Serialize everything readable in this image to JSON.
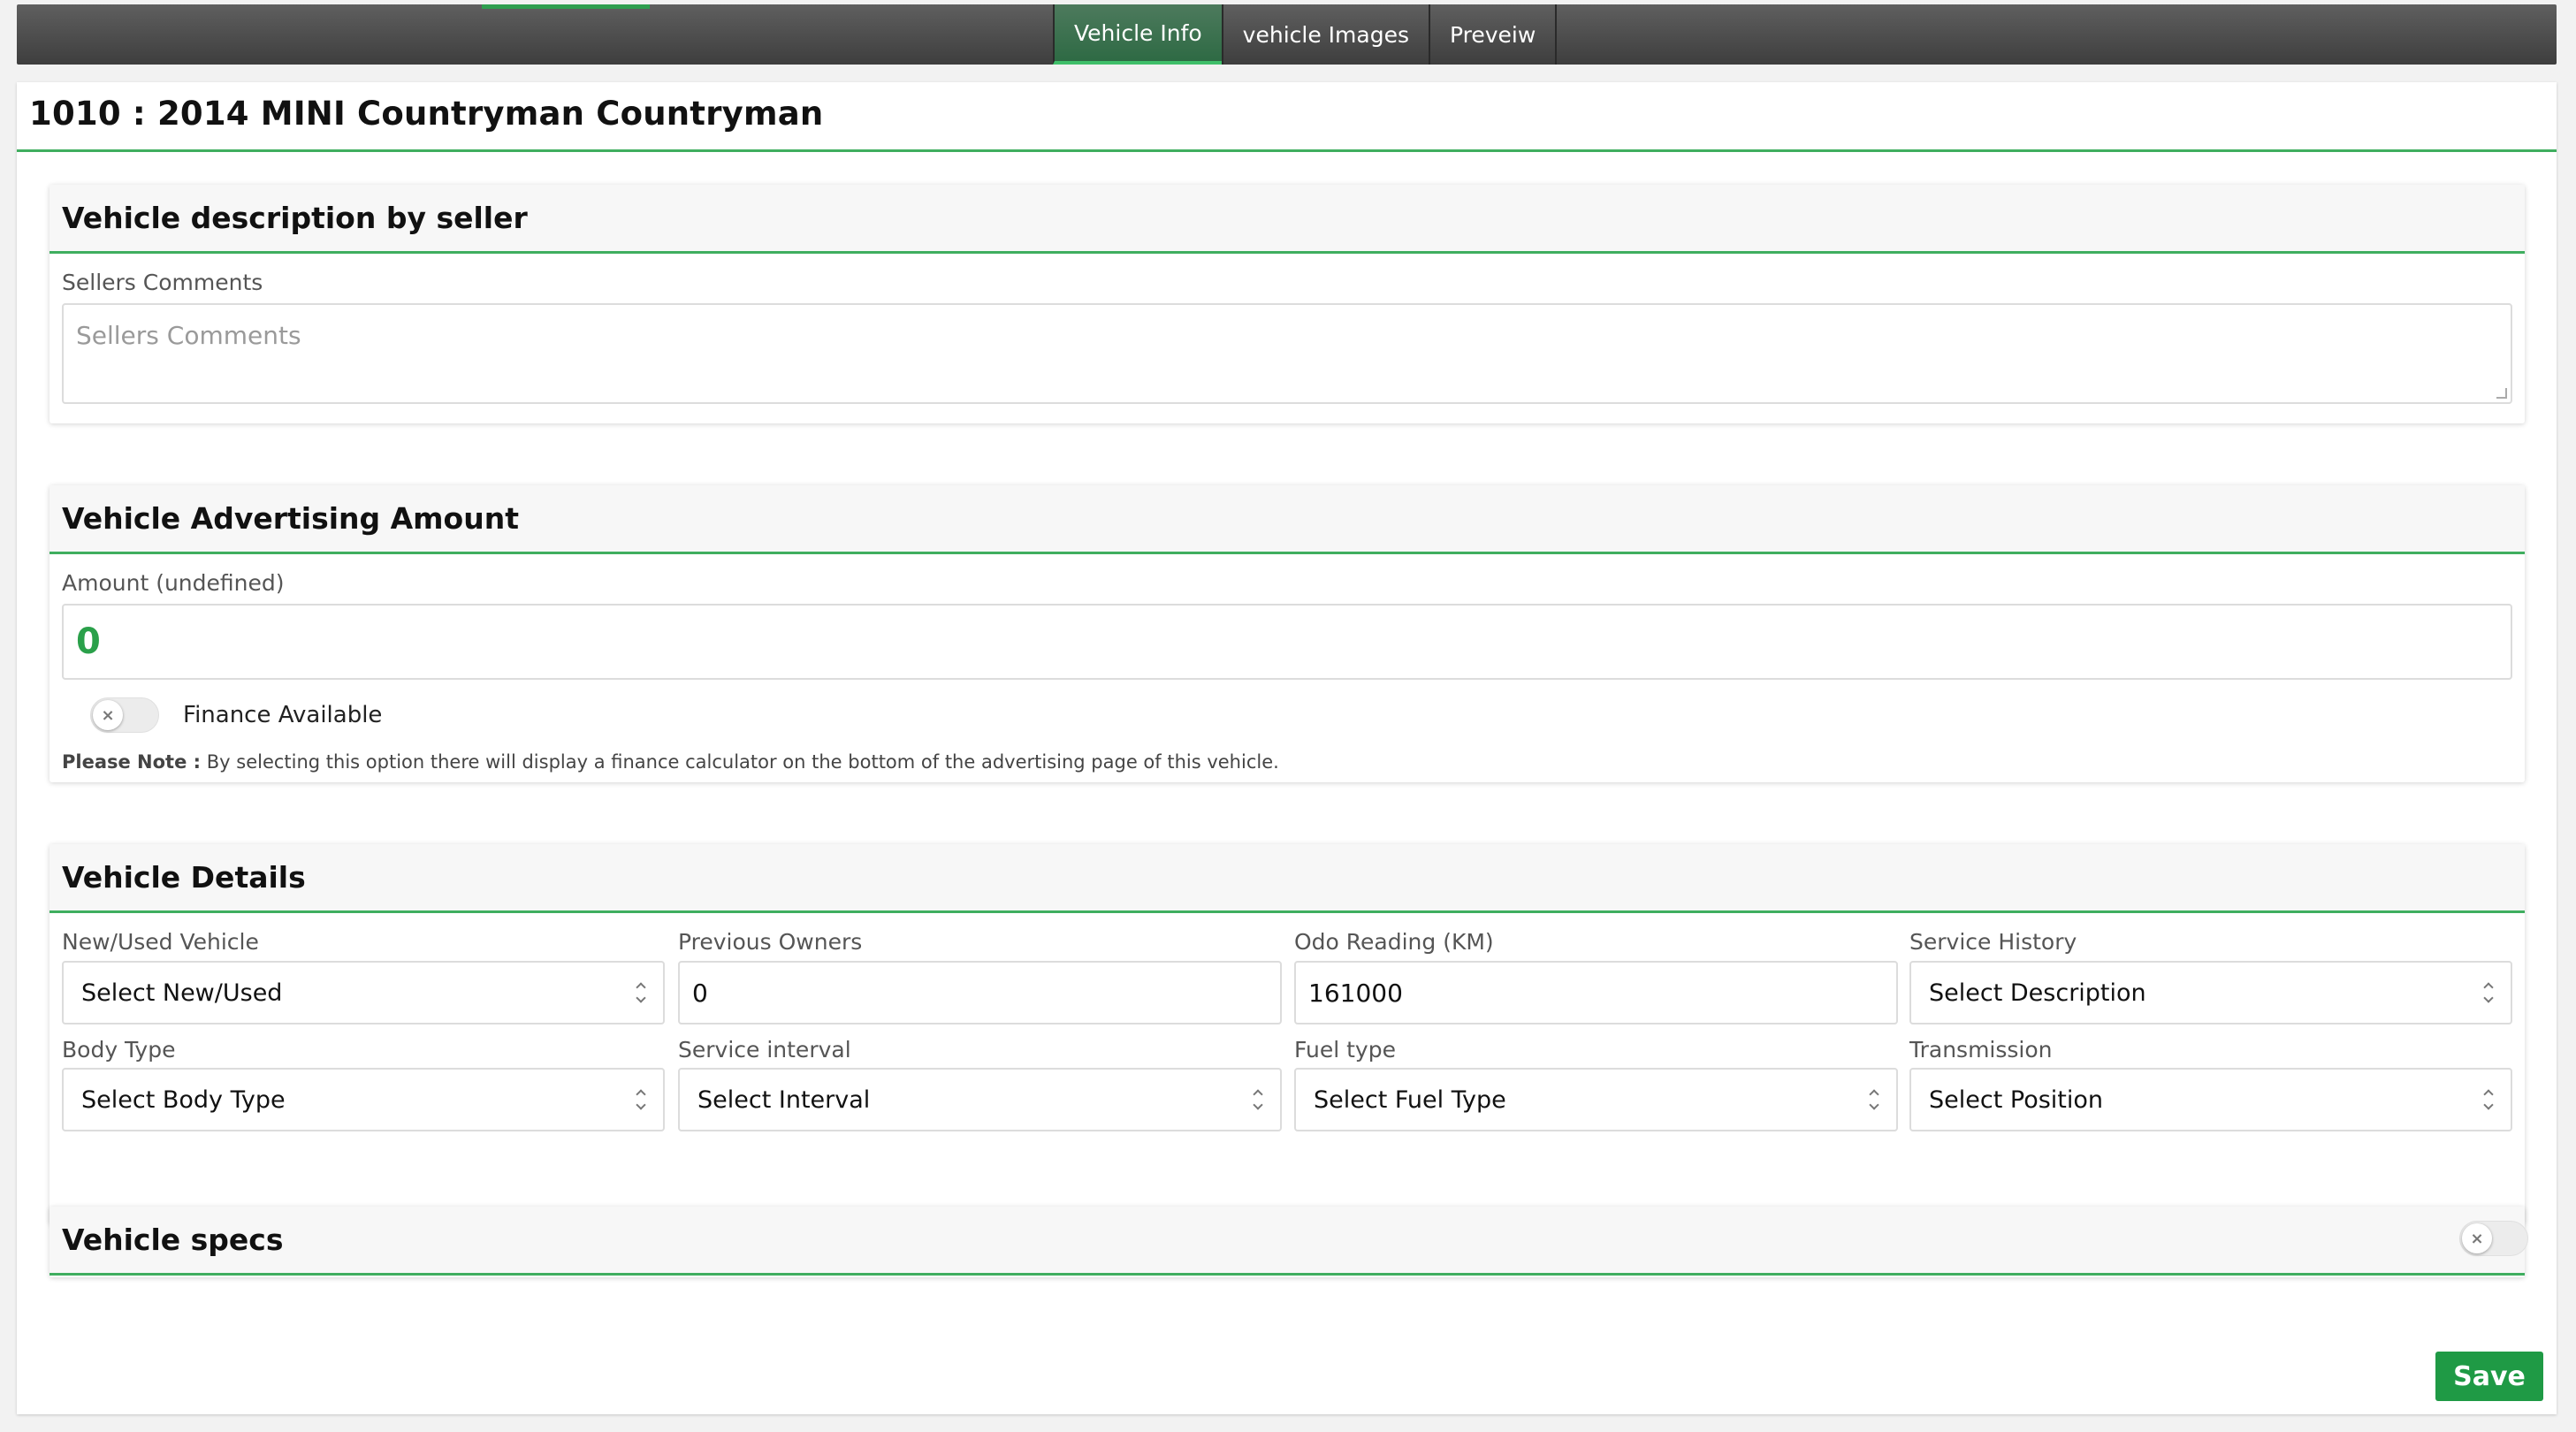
{
  "nav": {
    "tabs": [
      {
        "label": "Vehicle Info",
        "active": true
      },
      {
        "label": "vehicle Images",
        "active": false
      },
      {
        "label": "Preveiw",
        "active": false
      }
    ]
  },
  "page": {
    "title": "1010 : 2014 MINI Countryman Countryman"
  },
  "description_section": {
    "title": "Vehicle description by seller",
    "comments_label": "Sellers Comments",
    "comments_placeholder": "Sellers Comments",
    "comments_value": ""
  },
  "advertising_section": {
    "title": "Vehicle Advertising Amount",
    "amount_label": "Amount (undefined)",
    "amount_value": "0",
    "finance_toggle_label": "Finance Available",
    "finance_toggle_on": false,
    "toggle_off_glyph": "×",
    "note_prefix": "Please Note :",
    "note_text": "By selecting this option there will display a finance calculator on the bottom of the advertising page of this vehicle."
  },
  "details_section": {
    "title": "Vehicle Details",
    "fields": {
      "new_used": {
        "label": "New/Used Vehicle",
        "value": "Select New/Used"
      },
      "previous_owners": {
        "label": "Previous Owners",
        "value": "0"
      },
      "odo_reading": {
        "label": "Odo Reading (KM)",
        "value": "161000"
      },
      "service_history": {
        "label": "Service History",
        "value": "Select Description"
      },
      "body_type": {
        "label": "Body Type",
        "value": "Select Body Type"
      },
      "service_interval": {
        "label": "Service interval",
        "value": "Select Interval"
      },
      "fuel_type": {
        "label": "Fuel type",
        "value": "Select Fuel Type"
      },
      "transmission": {
        "label": "Transmission",
        "value": "Select Position"
      }
    }
  },
  "specs_section": {
    "title": "Vehicle specs",
    "toggle_on": false
  },
  "actions": {
    "save_label": "Save"
  },
  "colors": {
    "accent_green": "#3fae5f",
    "save_green": "#1f9a45",
    "nav_dark": "#4a4a4a"
  }
}
